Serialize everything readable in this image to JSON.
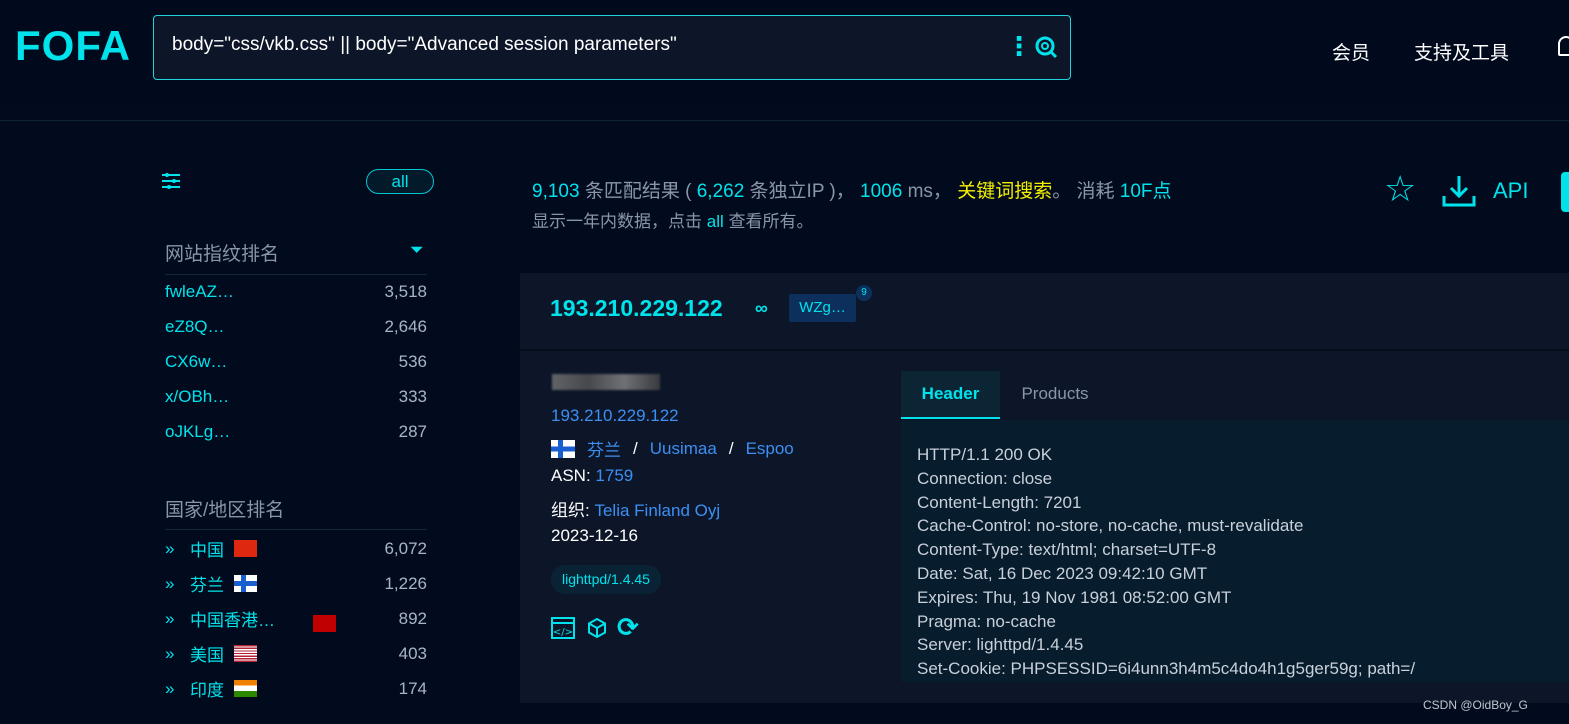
{
  "logo": "FOFA",
  "search": {
    "query": "body=\"css/vkb.css\" || body=\"Advanced session parameters\""
  },
  "nav": {
    "vip": "会员",
    "tools": "支持及工具"
  },
  "summary": {
    "count": "9,103",
    "count_label": "条匹配结果 (",
    "ips": "6,262",
    "ips_label": "条独立IP )，",
    "ms": "1006",
    "ms_label": "ms，",
    "keyword": "关键词搜索",
    "consume_label": "。 消耗",
    "points": "10F点",
    "note_prefix": "显示一年内数据，点击",
    "note_all": "all",
    "note_suffix": "查看所有。",
    "api": "API"
  },
  "sidebar": {
    "all_label": "all",
    "fingerprint_title": "网站指纹排名",
    "fingerprints": [
      {
        "name": "fwleAZ…",
        "count": "3,518"
      },
      {
        "name": "eZ8Q…",
        "count": "2,646"
      },
      {
        "name": "CX6w…",
        "count": "536"
      },
      {
        "name": "x/OBh…",
        "count": "333"
      },
      {
        "name": "oJKLg…",
        "count": "287"
      }
    ],
    "country_title": "国家/地区排名",
    "countries": [
      {
        "name": "中国",
        "flag": "cn",
        "count": "6,072"
      },
      {
        "name": "芬兰",
        "flag": "fi",
        "count": "1,226"
      },
      {
        "name": "中国香港…",
        "flag": "hk",
        "count": "892"
      },
      {
        "name": "美国",
        "flag": "us",
        "count": "403"
      },
      {
        "name": "印度",
        "flag": "in",
        "count": "174"
      }
    ]
  },
  "result": {
    "ip": "193.210.229.122",
    "tag": "WZg…",
    "tag_count": "9",
    "ip_link": "193.210.229.122",
    "country": "芬兰",
    "region": "Uusimaa",
    "city": "Espoo",
    "asn_label": "ASN:",
    "asn": "1759",
    "org_label": "组织:",
    "org": "Telia Finland Oyj",
    "date": "2023-12-16",
    "server_tag": "lighttpd/1.4.45",
    "tabs": [
      "Header",
      "Products"
    ],
    "header_lines": [
      "HTTP/1.1 200 OK",
      "Connection: close",
      "Content-Length: 7201",
      "Cache-Control: no-store, no-cache, must-revalidate",
      "Content-Type: text/html; charset=UTF-8",
      "Date: Sat, 16 Dec 2023 09:42:10 GMT",
      "Expires: Thu, 19 Nov 1981 08:52:00 GMT",
      "Pragma: no-cache",
      "Server: lighttpd/1.4.45",
      "Set-Cookie: PHPSESSID=6i4unn3h4m5c4do4h1g5ger59g; path=/"
    ]
  },
  "watermark": "CSDN @OidBoy_G",
  "colors": {
    "accent": "#00e3ec",
    "link": "#3d8ff2",
    "keyword": "#f5f000",
    "background": "#020b1e"
  }
}
